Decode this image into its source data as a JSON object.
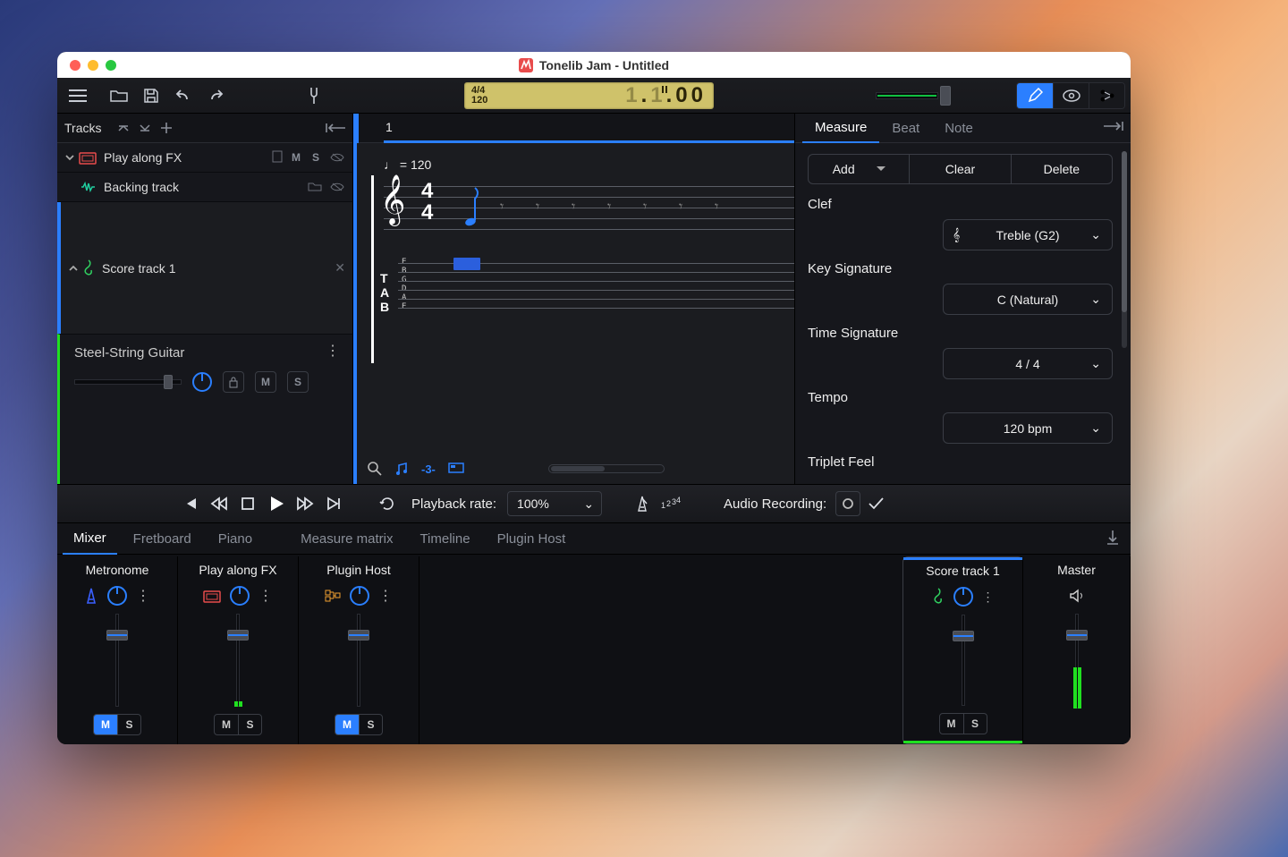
{
  "window_title": "Tonelib Jam - Untitled",
  "lcd": {
    "timesig": "4/4",
    "tempo": "120",
    "pos": "1.1.00"
  },
  "tracks_panel": {
    "header": "Tracks",
    "play_along": "Play along FX",
    "backing": "Backing track",
    "score": "Score track 1",
    "detail_instrument": "Steel-String Guitar",
    "M": "M",
    "S": "S"
  },
  "ruler": {
    "bar": "1"
  },
  "score": {
    "tempo_mark": "= 120",
    "ts_num": "4",
    "ts_den": "4",
    "tab_strings": "E\nB\nG\nD\nA\nE",
    "zoom3": "-3-"
  },
  "inspector": {
    "tabs": {
      "measure": "Measure",
      "beat": "Beat",
      "note": "Note"
    },
    "btns": {
      "add": "Add",
      "clear": "Clear",
      "delete": "Delete"
    },
    "clef_label": "Clef",
    "clef_value": "Treble (G2)",
    "key_label": "Key Signature",
    "key_value": "C (Natural)",
    "ts_label": "Time Signature",
    "ts_value": "4 / 4",
    "tempo_label": "Tempo",
    "tempo_value": "120 bpm",
    "triplet_label": "Triplet Feel"
  },
  "transport": {
    "playback_rate_label": "Playback rate:",
    "rate": "100%",
    "rec_label": "Audio Recording:"
  },
  "bottom_tabs": {
    "mixer": "Mixer",
    "fretboard": "Fretboard",
    "piano": "Piano",
    "matrix": "Measure matrix",
    "timeline": "Timeline",
    "plugin": "Plugin Host"
  },
  "mixer": {
    "M": "M",
    "S": "S",
    "strips": {
      "metronome": "Metronome",
      "playfx": "Play along FX",
      "plugin": "Plugin Host",
      "score": "Score track 1",
      "master": "Master"
    }
  }
}
